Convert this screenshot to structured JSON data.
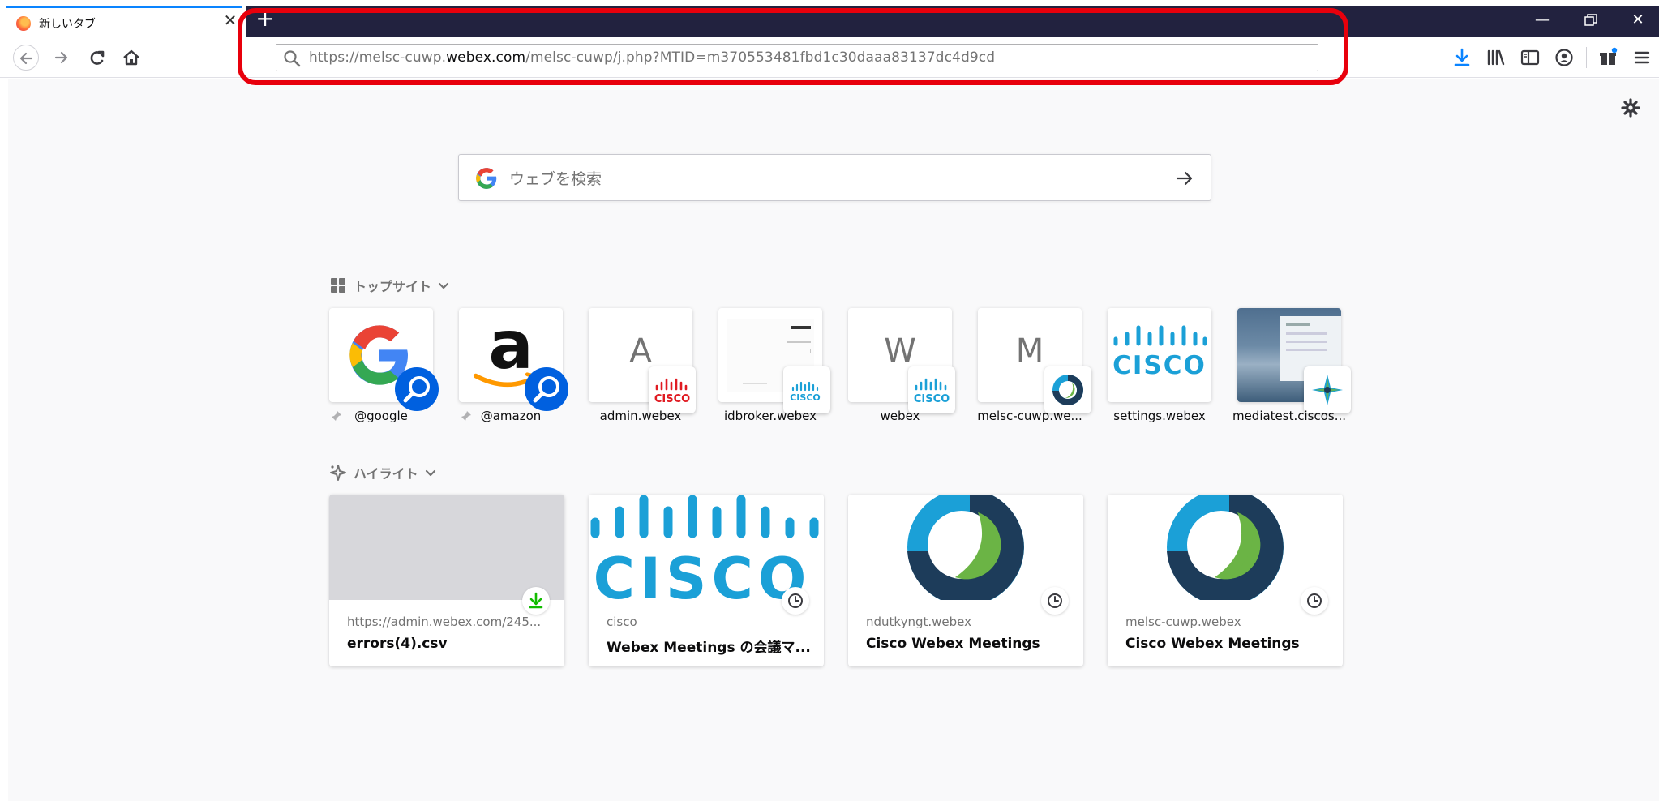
{
  "browser": {
    "tab": {
      "title": "新しいタブ"
    },
    "url": {
      "prefix": "https://melsc-cuwp.",
      "domain": "webex.com",
      "suffix": "/melsc-cuwp/j.php?MTID=m370553481fbd1c30daaa83137dc4d9cd"
    }
  },
  "search": {
    "placeholder": "ウェブを検索"
  },
  "top_sites": {
    "heading": "トップサイト",
    "items": [
      {
        "label": "@google"
      },
      {
        "label": "@amazon"
      },
      {
        "label": "admin.webex",
        "letter": "A"
      },
      {
        "label": "idbroker.webex"
      },
      {
        "label": "webex",
        "letter": "W"
      },
      {
        "label": "melsc-cuwp.we...",
        "letter": "M"
      },
      {
        "label": "settings.webex"
      },
      {
        "label": "mediatest.ciscos..."
      }
    ]
  },
  "highlights": {
    "heading": "ハイライト",
    "items": [
      {
        "source": "https://admin.webex.com/245...",
        "title": "errors(4).csv"
      },
      {
        "source": "cisco",
        "title": "Webex Meetings の会議マ..."
      },
      {
        "source": "ndutkyngt.webex",
        "title": "Cisco Webex Meetings"
      },
      {
        "source": "melsc-cuwp.webex",
        "title": "Cisco Webex Meetings"
      }
    ]
  },
  "logos": {
    "cisco_text": "CISCO"
  },
  "colors": {
    "accent": "#0a84ff",
    "tabstrip": "#22223f",
    "highlight_box": "#e8000c",
    "cisco_blue": "#1ba0d7",
    "webex_green": "#6bb445",
    "webex_navy": "#1d3c5a"
  },
  "icons": [
    "firefox-favicon",
    "close-icon",
    "plus-icon",
    "back-icon",
    "forward-icon",
    "reload-icon",
    "home-icon",
    "search-icon",
    "download-icon",
    "library-icon",
    "sidebar-icon",
    "account-icon",
    "gift-icon",
    "menu-icon",
    "gear-icon",
    "arrow-right-icon",
    "grid-icon",
    "sparkle-icon",
    "chevron-down-icon",
    "pin-icon",
    "clock-icon"
  ]
}
